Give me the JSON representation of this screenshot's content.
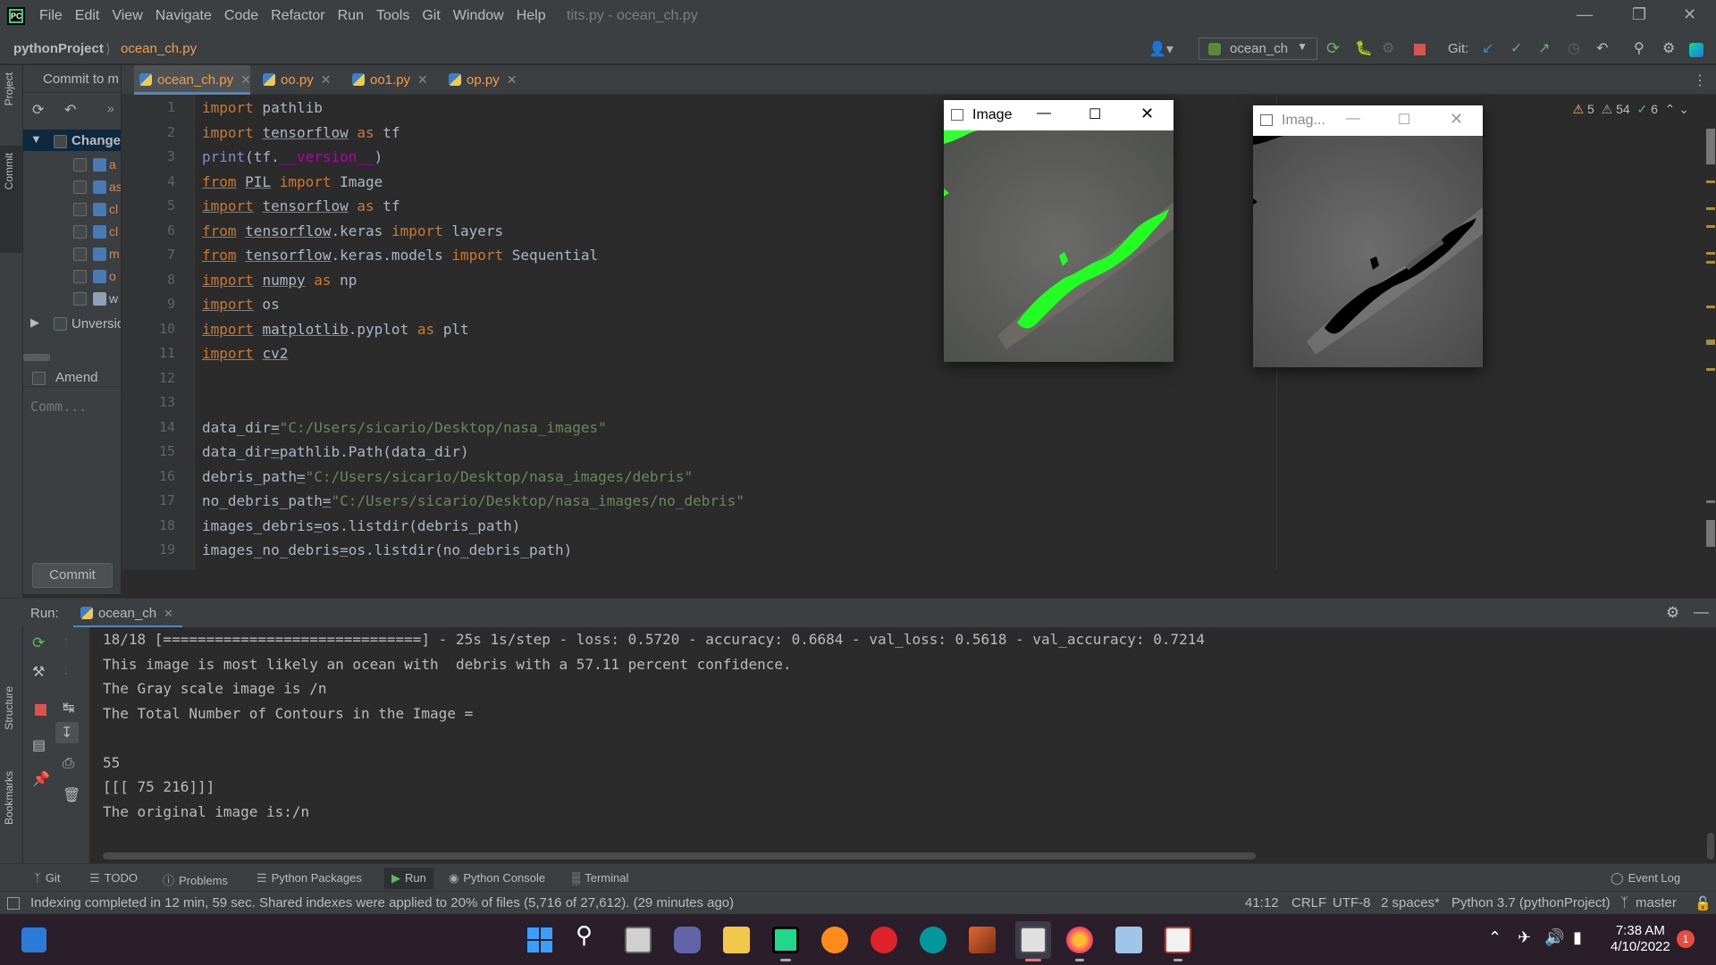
{
  "window": {
    "title": "tits.py - ocean_ch.py"
  },
  "menu": [
    "File",
    "Edit",
    "View",
    "Navigate",
    "Code",
    "Refactor",
    "Run",
    "Tools",
    "Git",
    "Window",
    "Help"
  ],
  "nav": {
    "project": "pythonProject",
    "file": "ocean_ch.py",
    "run_config": "ocean_ch",
    "git_label": "Git:"
  },
  "tabs": [
    {
      "label": "ocean_ch.py"
    },
    {
      "label": "oo.py"
    },
    {
      "label": "oo1.py"
    },
    {
      "label": "op.py"
    }
  ],
  "left_strip": {
    "project": "Project",
    "commit": "Commit",
    "structure": "Structure",
    "bookmarks": "Bookmarks"
  },
  "commit_panel": {
    "header": "Commit to m",
    "changes_label": "Changes",
    "files": [
      "a",
      "as",
      "cl",
      "cl",
      "m",
      "o",
      "w"
    ],
    "unversioned": "Unversio",
    "amend": "Amend",
    "message_placeholder": "Comm...",
    "commit_button": "Commit"
  },
  "editor": {
    "lines": [
      "1",
      "2",
      "3",
      "4",
      "5",
      "6",
      "7",
      "8",
      "9",
      "10",
      "11",
      "12",
      "13",
      "14",
      "15",
      "16",
      "17",
      "18",
      "19"
    ],
    "code_text": {
      "l13_str": "\"C:/Users/sicario/Desktop/nasa_images\"",
      "l15_str": "\"C:/Users/sicario/Desktop/nasa_images/debris\"",
      "l16_str": "\"C:/Users/sicario/Desktop/nasa_images/no_debris\""
    },
    "inspections": {
      "warnings": "5",
      "weak": "54",
      "ok": "6"
    }
  },
  "image_windows": [
    {
      "title": "Image"
    },
    {
      "title": "Imag..."
    }
  ],
  "run": {
    "label": "Run:",
    "tab": "ocean_ch",
    "console": [
      "18/18 [==============================] - 25s 1s/step - loss: 0.5720 - accuracy: 0.6684 - val_loss: 0.5618 - val_accuracy: 0.7214",
      "This image is most likely an ocean with  debris with a 57.11 percent confidence.",
      "The Gray scale image is /n",
      "The Total Number of Contours in the Image =",
      "",
      "55",
      "[[[ 75 216]]]",
      "The original image is:/n"
    ]
  },
  "tool_tabs": [
    "Git",
    "TODO",
    "Problems",
    "Python Packages",
    "Run",
    "Python Console",
    "Terminal",
    "Event Log"
  ],
  "status": {
    "message": "Indexing completed in 12 min, 59 sec. Shared indexes were applied to 20% of files (5,716 of 27,612). (29 minutes ago)",
    "position": "41:12",
    "line_sep": "CRLF",
    "encoding": "UTF-8",
    "indent": "2 spaces*",
    "interpreter": "Python 3.7 (pythonProject)",
    "branch": "master"
  },
  "taskbar": {
    "time": "7:38 AM",
    "date": "4/10/2022",
    "notifications": "1"
  },
  "colors": {
    "accent": "#4a88c7",
    "keyword": "#cc7832",
    "string": "#6a8759",
    "green_contour": "#22ff22"
  }
}
